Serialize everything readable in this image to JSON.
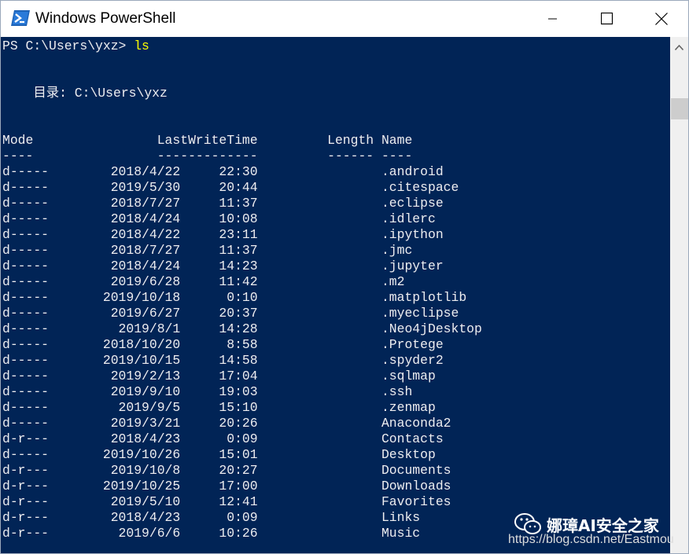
{
  "window": {
    "title": "Windows PowerShell",
    "controls": {
      "minimize": "minimize-icon",
      "maximize": "maximize-icon",
      "close": "close-icon"
    }
  },
  "colors": {
    "console_bg": "#012456",
    "console_fg": "#eeedf0",
    "command": "#ffff00"
  },
  "console": {
    "prompt": "PS C:\\Users\\yxz> ",
    "command": "ls",
    "directory_label": "    目录: C:\\Users\\yxz",
    "header": "Mode                LastWriteTime         Length Name",
    "separator": "----                -------------         ------ ----",
    "rows": [
      "d-----        2018/4/22     22:30                .android",
      "d-----        2019/5/30     20:44                .citespace",
      "d-----        2018/7/27     11:37                .eclipse",
      "d-----        2018/4/24     10:08                .idlerc",
      "d-----        2018/4/22     23:11                .ipython",
      "d-----        2018/7/27     11:37                .jmc",
      "d-----        2018/4/24     14:23                .jupyter",
      "d-----        2019/6/28     11:42                .m2",
      "d-----       2019/10/18      0:10                .matplotlib",
      "d-----        2019/6/27     20:37                .myeclipse",
      "d-----         2019/8/1     14:28                .Neo4jDesktop",
      "d-----       2018/10/20      8:58                .Protege",
      "d-----       2019/10/15     14:58                .spyder2",
      "d-----        2019/2/13     17:04                .sqlmap",
      "d-----        2019/9/10     19:03                .ssh",
      "d-----         2019/9/5     15:10                .zenmap",
      "d-----        2019/3/21     20:26                Anaconda2",
      "d-r---        2018/4/23      0:09                Contacts",
      "d-----       2019/10/26     15:01                Desktop",
      "d-r---        2019/10/8     20:27                Documents",
      "d-r---       2019/10/25     17:00                Downloads",
      "d-r---        2019/5/10     12:41                Favorites",
      "d-r---        2018/4/23      0:09                Links",
      "d-r---         2019/6/6     10:26                Music"
    ]
  },
  "watermark": {
    "text": "娜璋AI安全之家",
    "url": "https://blog.csdn.net/Eastmou"
  }
}
